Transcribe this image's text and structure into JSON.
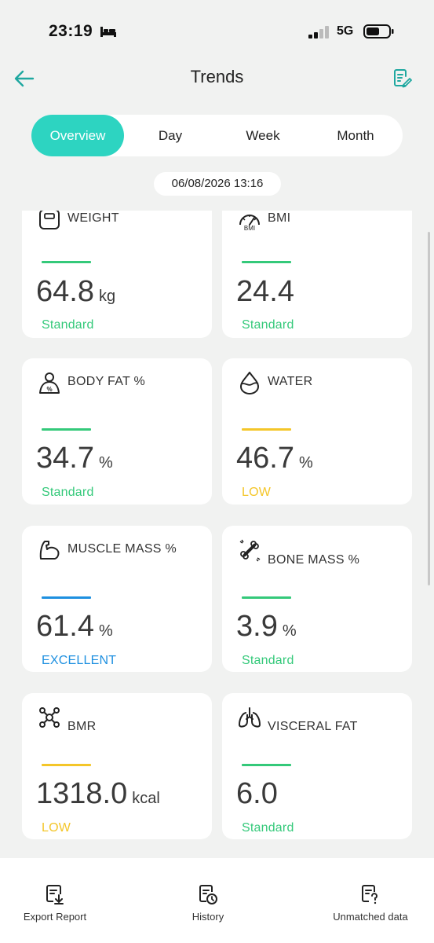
{
  "status_bar": {
    "time": "23:19",
    "network": "5G"
  },
  "header": {
    "title": "Trends"
  },
  "tabs": [
    "Overview",
    "Day",
    "Week",
    "Month"
  ],
  "timestamp": "06/08/2026 13:16",
  "colors": {
    "accent": "#2dd4c1",
    "standard": "#34c97a",
    "low": "#f4c629",
    "excellent": "#1e90e0"
  },
  "metrics": [
    {
      "label": "WEIGHT",
      "value": "64.8",
      "unit": "kg",
      "status": "Standard",
      "icon": "scale-icon"
    },
    {
      "label": "BMI",
      "value": "24.4",
      "unit": "",
      "status": "Standard",
      "icon": "bmi-gauge-icon"
    },
    {
      "label": "BODY FAT %",
      "value": "34.7",
      "unit": "%",
      "status": "Standard",
      "icon": "body-fat-icon"
    },
    {
      "label": "WATER",
      "value": "46.7",
      "unit": "%",
      "status": "LOW",
      "icon": "water-drop-icon"
    },
    {
      "label": "MUSCLE MASS %",
      "value": "61.4",
      "unit": "%",
      "status": "EXCELLENT",
      "icon": "muscle-arm-icon"
    },
    {
      "label": "BONE MASS %",
      "value": "3.9",
      "unit": "%",
      "status": "Standard",
      "icon": "bone-icon"
    },
    {
      "label": "BMR",
      "value": "1318.0",
      "unit": "kcal",
      "status": "LOW",
      "icon": "molecule-icon"
    },
    {
      "label": "VISCERAL FAT",
      "value": "6.0",
      "unit": "",
      "status": "Standard",
      "icon": "lungs-icon"
    }
  ],
  "bottom_nav": {
    "export": "Export Report",
    "history": "History",
    "unmatched": "Unmatched data"
  }
}
